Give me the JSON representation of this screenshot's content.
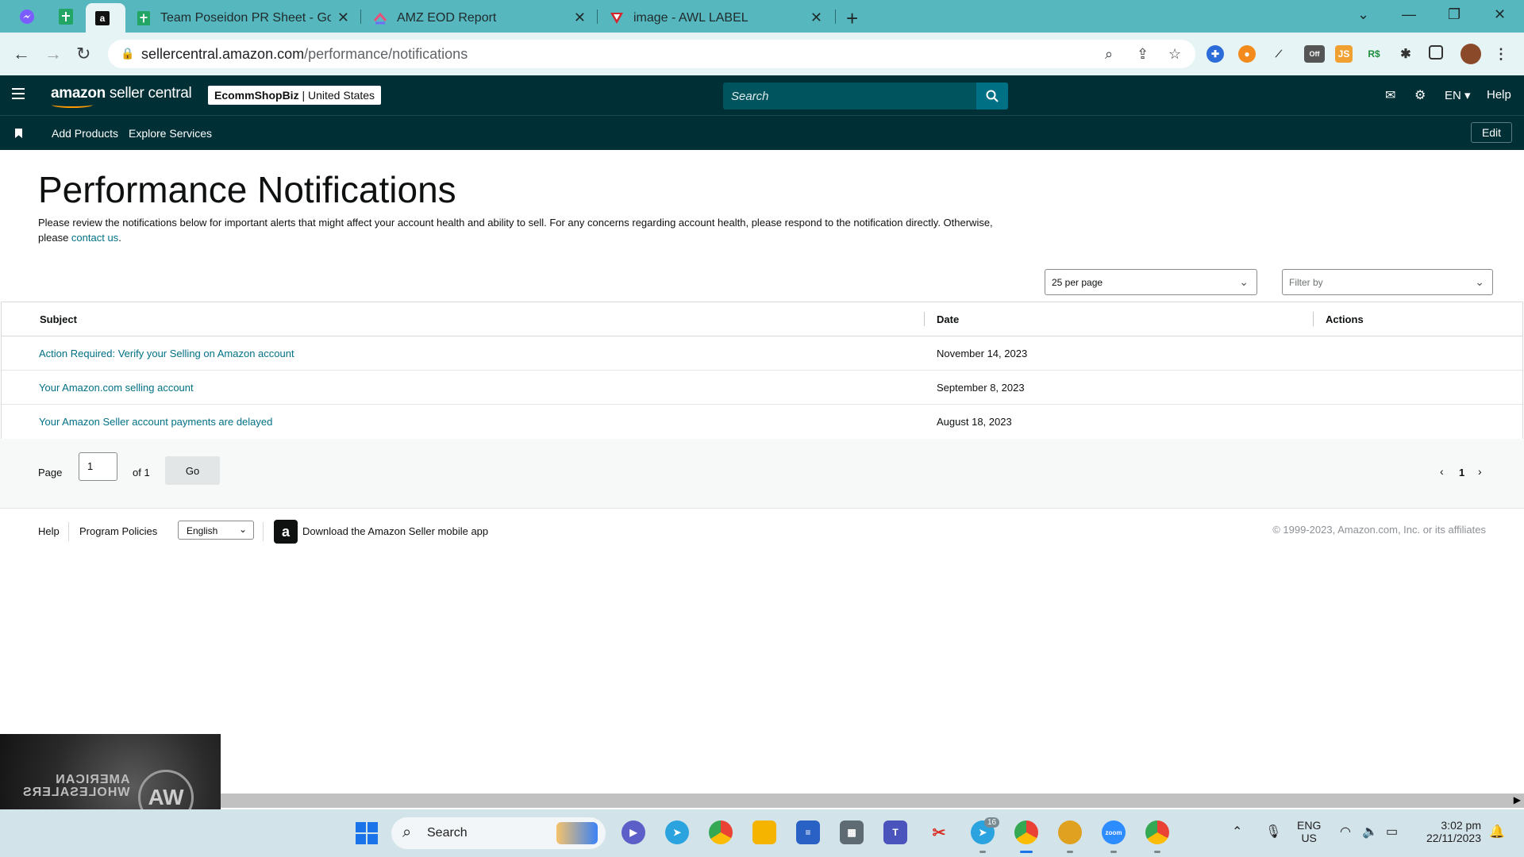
{
  "browser": {
    "tabs": [
      {
        "title": "Team Poseidon PR Sheet - Goog"
      },
      {
        "title": "AMZ EOD Report"
      },
      {
        "title": "image - AWL LABEL"
      }
    ],
    "url_host": "sellercentral.amazon.com",
    "url_path": "/performance/notifications"
  },
  "header": {
    "logo_bold": "amazon",
    "logo_rest": " seller central",
    "store_name": "EcommShopBiz",
    "store_region": " | United States",
    "search_placeholder": "Search",
    "language": "EN",
    "help": "Help"
  },
  "subnav": {
    "items": [
      "Add Products",
      "Explore Services"
    ],
    "edit": "Edit"
  },
  "page": {
    "title": "Performance Notifications",
    "intro_text": "Please review the notifications below for important alerts that might affect your account health and ability to sell. For any concerns regarding account health, please respond to the notification directly. Otherwise, please ",
    "intro_link": "contact us",
    "intro_end": "."
  },
  "controls": {
    "per_page": "25 per page",
    "filter_placeholder": "Filter by"
  },
  "table": {
    "headers": [
      "Subject",
      "Date",
      "Actions"
    ],
    "rows": [
      {
        "subject": "Action Required: Verify your Selling on Amazon account",
        "date": "November 14, 2023"
      },
      {
        "subject": "Your Amazon.com selling account",
        "date": "September 8, 2023"
      },
      {
        "subject": "Your Amazon Seller account payments are delayed",
        "date": "August 18, 2023"
      }
    ]
  },
  "pagination": {
    "page_label": "Page",
    "page_value": "1",
    "of_label": "of 1",
    "go": "Go",
    "current": "1"
  },
  "footer": {
    "help": "Help",
    "program_policies": "Program Policies",
    "language": "English",
    "app_link": "Download the Amazon Seller mobile app",
    "copyright": "© 1999-2023, Amazon.com, Inc. or its affiliates"
  },
  "overlay": {
    "watermark_line1": "AMERICAN",
    "watermark_line2": "WHOLESALERS"
  },
  "taskbar": {
    "search_placeholder": "Search",
    "telegram_badge": "16",
    "lang_line1": "ENG",
    "lang_line2": "US",
    "time": "3:02 pm",
    "date": "22/11/2023"
  },
  "colors": {
    "header_bg": "#002f36",
    "link": "#007185",
    "tabbar": "#57b7bf",
    "logo_smile": "#ff9900"
  }
}
